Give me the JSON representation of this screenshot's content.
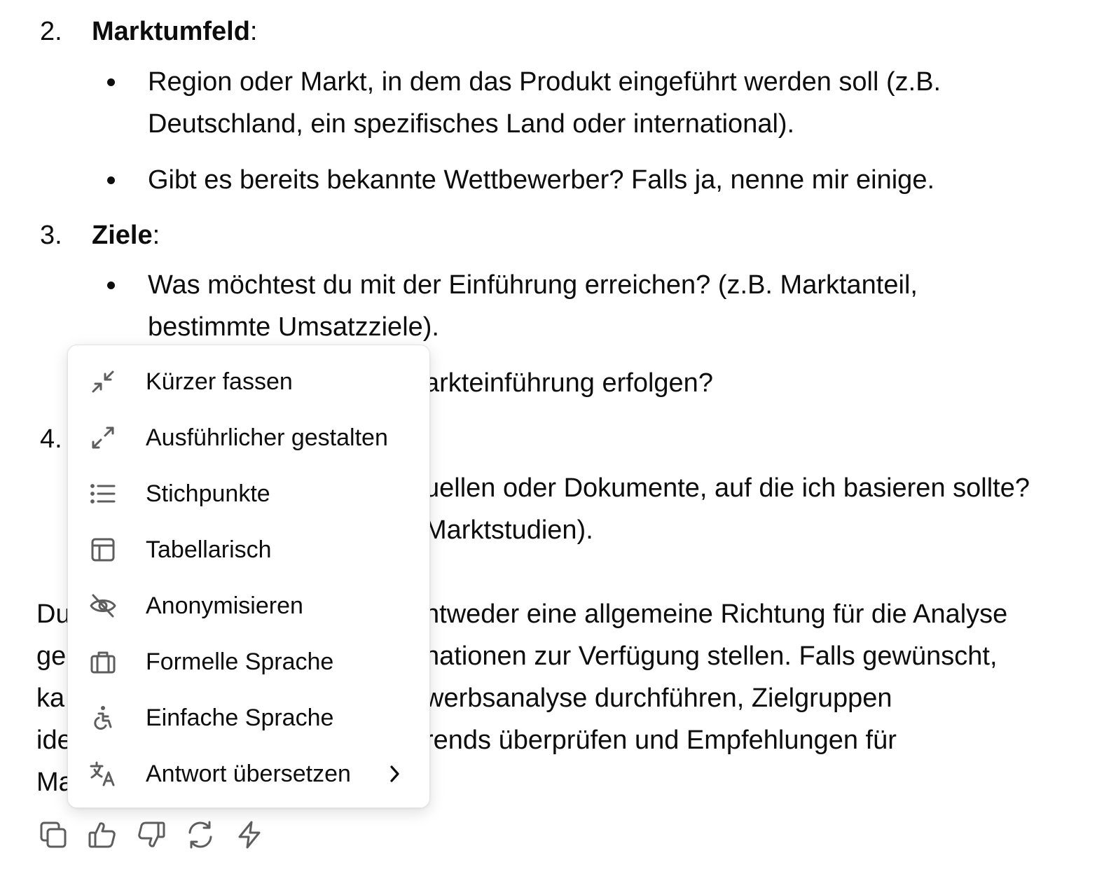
{
  "content": {
    "item2": {
      "number": "2.",
      "title": "Marktumfeld",
      "colon": ":",
      "b1_line1": "Region oder Markt, in dem das Produkt eingeführt werden soll (z.B.",
      "b1_line2": "Deutschland, ein spezifisches Land oder international).",
      "b2_line1": "Gibt es bereits bekannte Wettbewerber? Falls ja, nenne mir einige."
    },
    "item3": {
      "number": "3.",
      "title": "Ziele",
      "colon": ":",
      "b1_line1": "Was möchtest du mit der Einführung erreichen? (z.B. Marktanteil,",
      "b1_line2": "bestimmte Umsatzziele).",
      "b2_line1_visible": "arkteinführung erfolgen?"
    },
    "item4": {
      "number": "4.",
      "b1_line1_visible": "uellen oder Dokumente, auf die ich basieren sollte?",
      "b1_line2_visible": "Marktstudien)."
    },
    "closing": {
      "line1_left": "Du",
      "line1_right": "ntweder eine allgemeine Richtung für die Analyse",
      "line2_left": "ge",
      "line2_right": "nationen zur Verfügung stellen. Falls gewünscht,",
      "line3_left": "ka",
      "line3_right": "werbsanalyse durchführen, Zielgruppen",
      "line4_left": "ide",
      "line4_right": "rends überprüfen und Empfehlungen für",
      "line5_left": "Ma"
    }
  },
  "menu": {
    "items": [
      {
        "label": "Kürzer fassen",
        "icon": "shrink-arrows-icon"
      },
      {
        "label": "Ausführlicher gestalten",
        "icon": "expand-arrows-icon"
      },
      {
        "label": "Stichpunkte",
        "icon": "bullet-list-icon"
      },
      {
        "label": "Tabellarisch",
        "icon": "table-icon"
      },
      {
        "label": "Anonymisieren",
        "icon": "eye-off-icon"
      },
      {
        "label": "Formelle Sprache",
        "icon": "briefcase-icon"
      },
      {
        "label": "Einfache Sprache",
        "icon": "accessibility-icon"
      },
      {
        "label": "Antwort übersetzen",
        "icon": "translate-icon",
        "submenu_icon": "chevron-right-icon"
      }
    ]
  },
  "actions": [
    "copy-icon",
    "thumbs-up-icon",
    "thumbs-down-icon",
    "regenerate-icon",
    "lightning-icon"
  ],
  "colors": {
    "text": "#0d0d0d",
    "icon": "#5d5d5d",
    "menu_border": "#e3e3e3"
  }
}
